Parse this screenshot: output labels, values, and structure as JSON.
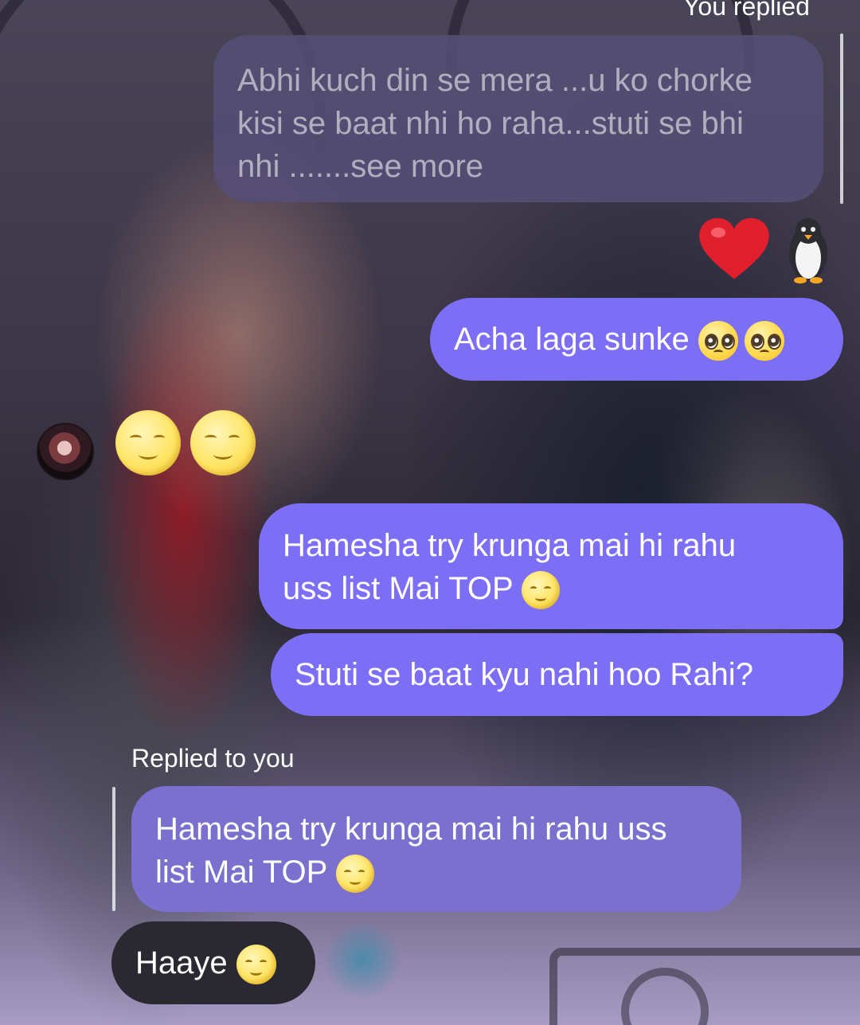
{
  "chat": {
    "you_replied_label": "You replied",
    "quoted_own_message": {
      "line1": "Abhi kuch din se mera ...u ko chorke",
      "line2": "kisi se baat nhi ho raha...stuti se bhi",
      "line3": "nhi .......see more"
    },
    "reactions": [
      "heart-icon",
      "penguin-icon"
    ],
    "message_acha": "Acha laga sunke ",
    "incoming_emoji_message": [
      "moon-face-icon",
      "moon-face-icon"
    ],
    "message_hamesha": {
      "line1": "Hamesha try krunga mai hi rahu",
      "line2": "uss list Mai TOP "
    },
    "message_stuti": "Stuti se baat kyu nahi hoo Rahi?",
    "replied_to_you_label": "Replied to you",
    "reply_quote": {
      "line1": "Hamesha try krunga mai hi rahu uss",
      "line2": "list Mai TOP "
    },
    "message_haaye": "Haaye "
  },
  "colors": {
    "sent_bubble": "#7d6ff5",
    "received_bubble": "#2a2830",
    "quoted_bubble": "#554e76",
    "reply_quote_bubble": "#7c70cf"
  }
}
